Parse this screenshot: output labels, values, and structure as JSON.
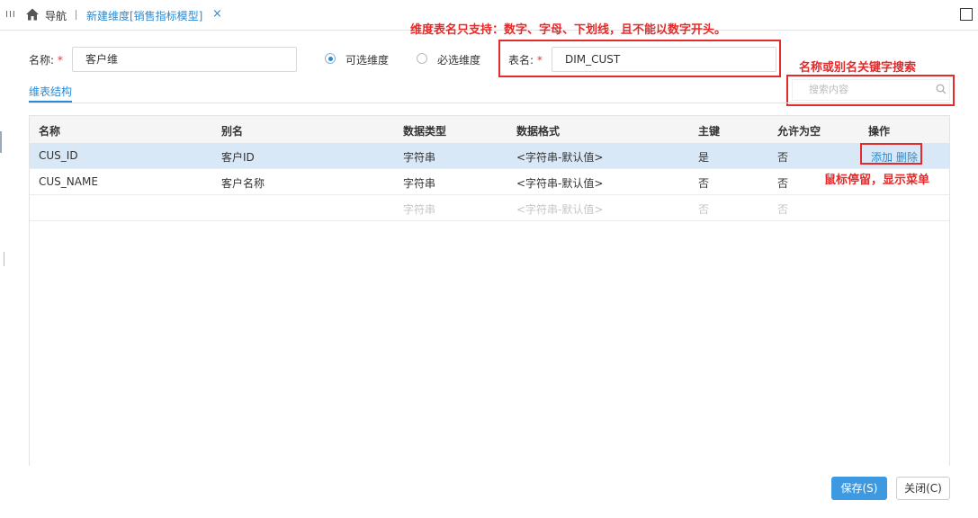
{
  "topbar": {
    "menu_glyph": "III",
    "nav_label": "导航",
    "tab_title": "新建维度[销售指标模型]",
    "tab_close": "×"
  },
  "form": {
    "name_label": "名称:",
    "required_mark": "*",
    "name_value": "客户维",
    "radio_optional": "可选维度",
    "radio_required": "必选维度",
    "table_name_label": "表名:",
    "table_name_value": "DIM_CUST"
  },
  "annotations": {
    "table_name_rule": "维度表名只支持：数字、字母、下划线，且不能以数字开头。",
    "search_hint": "名称或别名关键字搜索",
    "hover_hint": "鼠标停留，显示菜单",
    "color": "#e32b2b"
  },
  "subtab": {
    "label": "维表结构"
  },
  "search": {
    "placeholder": "搜索内容"
  },
  "table": {
    "columns": [
      "名称",
      "别名",
      "数据类型",
      "数据格式",
      "主键",
      "允许为空",
      "操作"
    ],
    "rows": [
      {
        "name": "CUS_ID",
        "alias": "客户ID",
        "type": "字符串",
        "format": "<字符串-默认值>",
        "pk": "是",
        "nullable": "否",
        "op_add": "添加",
        "op_delete": "删除"
      },
      {
        "name": "CUS_NAME",
        "alias": "客户名称",
        "type": "字符串",
        "format": "<字符串-默认值>",
        "pk": "否",
        "nullable": "否"
      }
    ],
    "ghost_row": {
      "type": "字符串",
      "format": "<字符串-默认值>",
      "pk": "否",
      "nullable": "否"
    }
  },
  "buttons": {
    "save": "保存(S)",
    "close": "关闭(C)"
  },
  "colors": {
    "accent": "#2b8ad2",
    "selected_row": "#d8e8f7",
    "save_button": "#3d99e0"
  },
  "icons": [
    "menu-icon",
    "home-icon",
    "close-icon",
    "maximize-icon",
    "search-icon"
  ]
}
